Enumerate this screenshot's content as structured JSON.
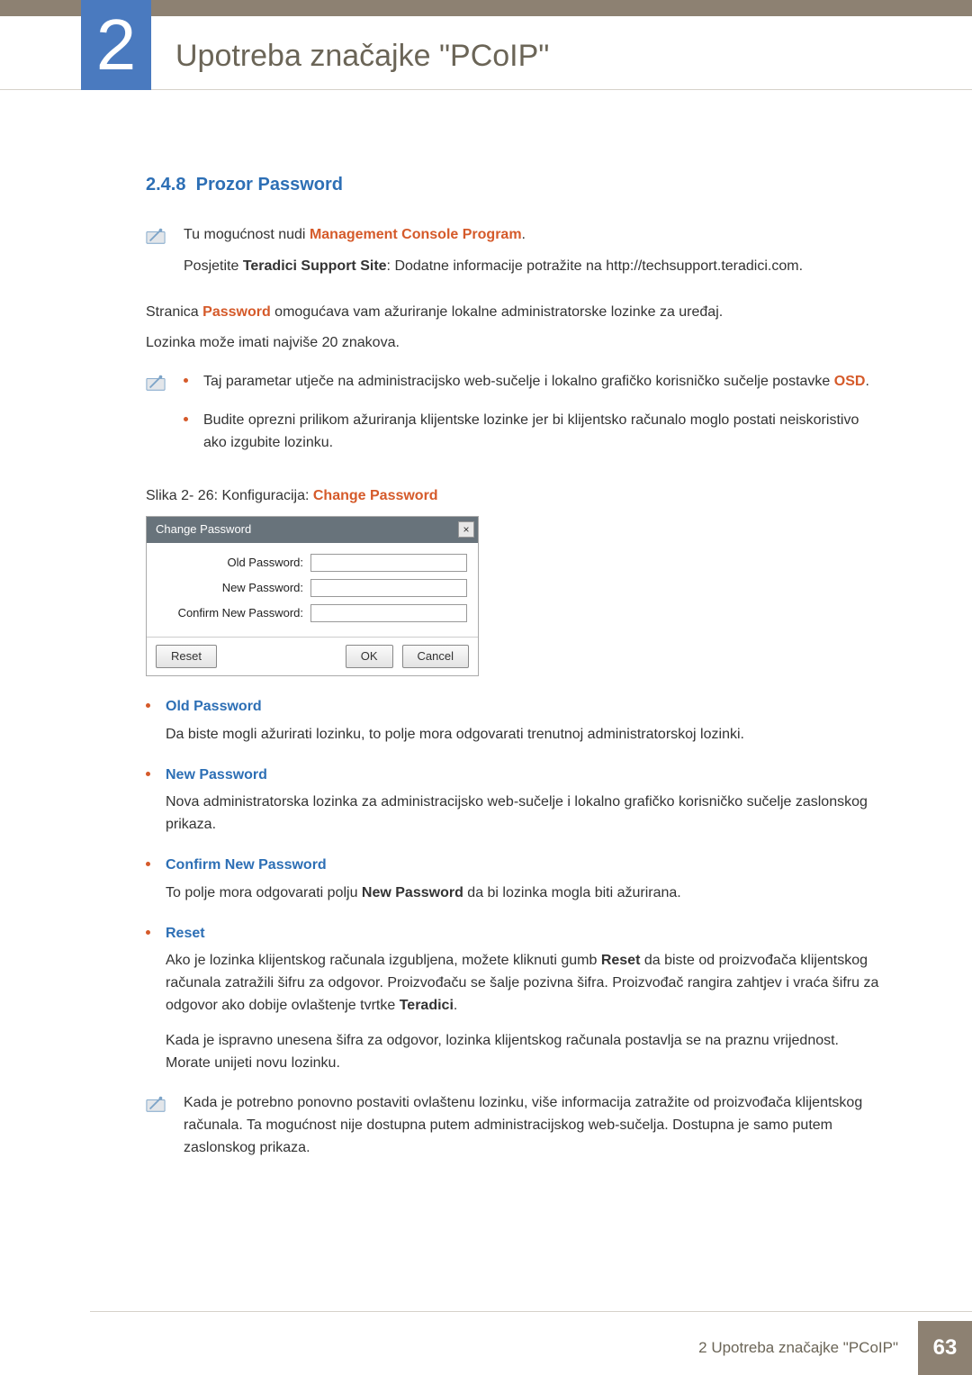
{
  "chapter": {
    "number": "2",
    "title": "Upotreba značajke \"PCoIP\""
  },
  "section": {
    "number": "2.4.8",
    "title": "Prozor Password"
  },
  "intro_note": {
    "line1_pre": "Tu mogućnost nudi ",
    "line1_hi": "Management Console Program",
    "line1_post": ".",
    "line2_pre": "Posjetite ",
    "line2_bold": "Teradici Support Site",
    "line2_post": ": Dodatne informacije potražite na http://techsupport.teradici.com."
  },
  "body1_pre": "Stranica ",
  "body1_hi": "Password",
  "body1_post": " omogućava vam ažuriranje lokalne administratorske lozinke za uređaj.",
  "body2": "Lozinka može imati najviše 20 znakova.",
  "warn_bullets": {
    "b1_pre": "Taj parametar utječe na administracijsko web-sučelje i lokalno grafičko korisničko sučelje postavke ",
    "b1_hi": "OSD",
    "b1_post": ".",
    "b2": "Budite oprezni prilikom ažuriranja klijentske lozinke jer bi klijentsko računalo moglo postati neiskoristivo ako izgubite lozinku."
  },
  "caption_pre": "Slika 2- 26: Konfiguracija: ",
  "caption_hi": "Change Password",
  "dialog": {
    "title": "Change Password",
    "close": "×",
    "old": "Old Password:",
    "new": "New Password:",
    "confirm": "Confirm New Password:",
    "reset": "Reset",
    "ok": "OK",
    "cancel": "Cancel"
  },
  "fields": {
    "old": {
      "name": "Old Password",
      "desc": "Da biste mogli ažurirati lozinku, to polje mora odgovarati trenutnoj administratorskoj lozinki."
    },
    "new": {
      "name": "New Password",
      "desc": "Nova administratorska lozinka za administracijsko web-sučelje i lokalno grafičko korisničko sučelje zaslonskog prikaza."
    },
    "confirm": {
      "name": "Confirm New Password",
      "desc_pre": "To polje mora odgovarati polju ",
      "desc_bold": "New Password",
      "desc_post": " da bi lozinka mogla biti ažurirana."
    },
    "reset": {
      "name": "Reset",
      "p1_pre": "Ako je lozinka klijentskog računala izgubljena, možete kliknuti gumb ",
      "p1_bold": "Reset",
      "p1_mid": " da biste od proizvođača klijentskog računala zatražili šifru za odgovor. Proizvođaču se šalje pozivna šifra. Proizvođač rangira zahtjev i vraća šifru za odgovor ako dobije ovlaštenje tvrtke ",
      "p1_bold2": "Teradici",
      "p1_post": ".",
      "p2": "Kada je ispravno unesena šifra za odgovor, lozinka klijentskog računala postavlja se na praznu vrijednost. Morate unijeti novu lozinku."
    }
  },
  "final_note": "Kada je potrebno ponovno postaviti ovlaštenu lozinku, više informacija zatražite od proizvođača klijentskog računala. Ta mogućnost nije dostupna putem administracijskog web-sučelja. Dostupna je samo putem zaslonskog prikaza.",
  "footer": {
    "label": "2 Upotreba značajke \"PCoIP\"",
    "page": "63"
  }
}
